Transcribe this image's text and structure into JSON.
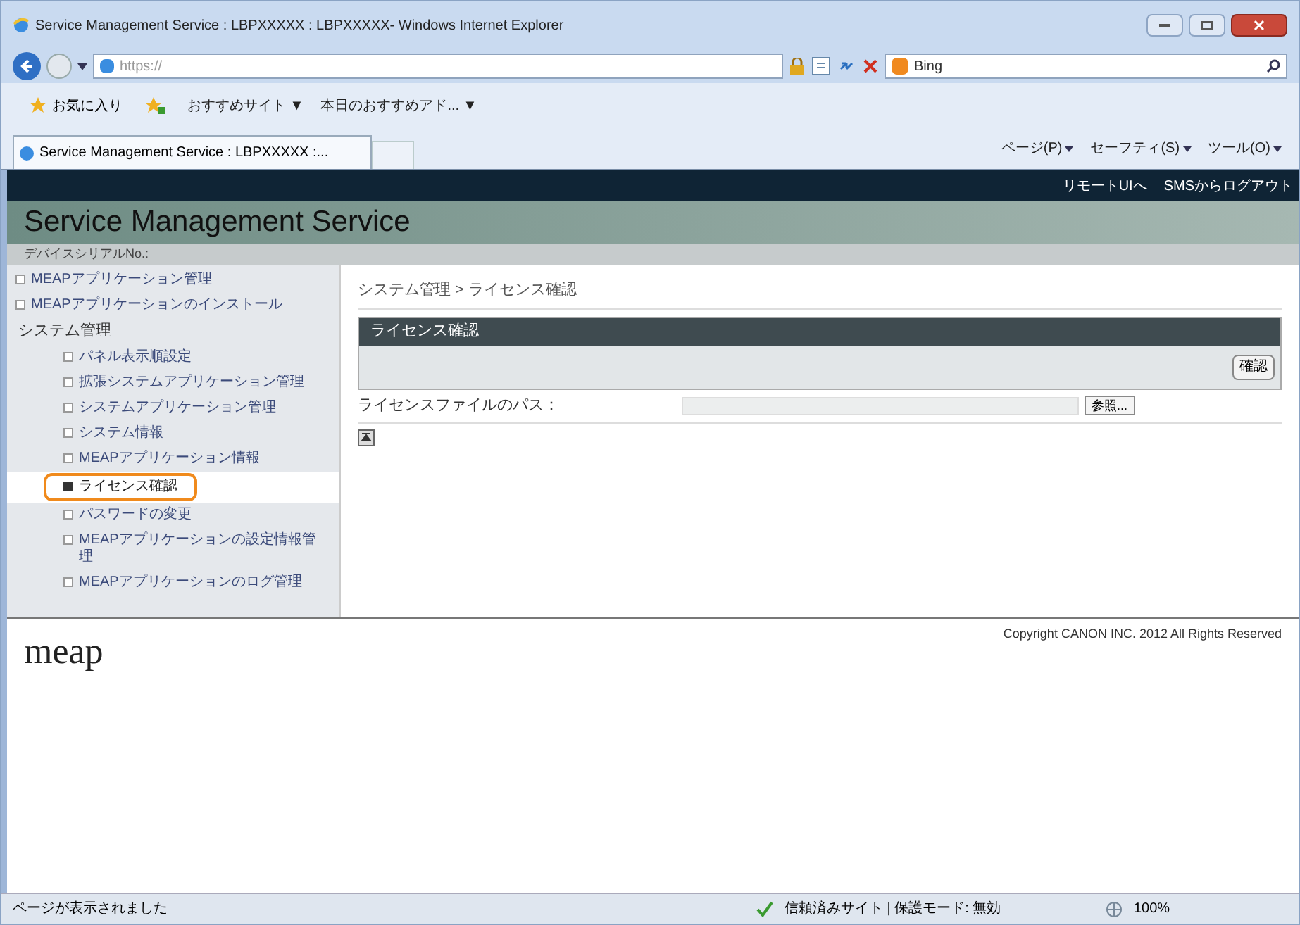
{
  "window": {
    "title": "Service Management Service : LBPXXXXX : LBPXXXXX- Windows Internet Explorer"
  },
  "address_bar": {
    "url": "https://"
  },
  "search": {
    "value": "Bing"
  },
  "favorites_bar": {
    "favorites": "お気に入り",
    "items": [
      "おすすめサイト ▼",
      "本日のおすすめアド... ▼"
    ]
  },
  "tab": {
    "label": "Service Management Service : LBPXXXXX :..."
  },
  "command_bar": [
    "ページ(P)",
    "セーフティ(S)",
    "ツール(O)"
  ],
  "page": {
    "top_links": [
      "リモートUIへ",
      "SMSからログアウト"
    ],
    "title": "Service Management Service",
    "serial_label": "デバイスシリアルNo.:",
    "sidebar": [
      {
        "kind": "link",
        "label": "MEAPアプリケーション管理",
        "selected": false
      },
      {
        "kind": "link",
        "label": "MEAPアプリケーションのインストール",
        "selected": false
      },
      {
        "kind": "group",
        "label": "システム管理",
        "children": [
          {
            "kind": "link",
            "label": "パネル表示順設定",
            "selected": false
          },
          {
            "kind": "link",
            "label": "拡張システムアプリケーション管理",
            "selected": false
          },
          {
            "kind": "link",
            "label": "システムアプリケーション管理",
            "selected": false
          },
          {
            "kind": "link",
            "label": "システム情報",
            "selected": false
          },
          {
            "kind": "link",
            "label": "MEAPアプリケーション情報",
            "selected": false
          },
          {
            "kind": "link",
            "label": "ライセンス確認",
            "selected": true
          },
          {
            "kind": "link",
            "label": "パスワードの変更",
            "selected": false
          },
          {
            "kind": "link",
            "label": "MEAPアプリケーションの設定情報管理",
            "selected": false
          },
          {
            "kind": "link",
            "label": "MEAPアプリケーションのログ管理",
            "selected": false
          }
        ]
      }
    ],
    "breadcrumb": "システム管理 > ライセンス確認",
    "panel": {
      "title": "ライセンス確認",
      "button": "確認"
    },
    "field": {
      "label": "ライセンスファイルのパス：",
      "browse": "参照..."
    },
    "copyright": "Copyright CANON INC. 2012 All Rights Reserved",
    "logo": "meap"
  },
  "status_bar": {
    "text": "ページが表示されました",
    "zone": "信頼済みサイト | 保護モード: 無効",
    "zoom": "100%"
  }
}
